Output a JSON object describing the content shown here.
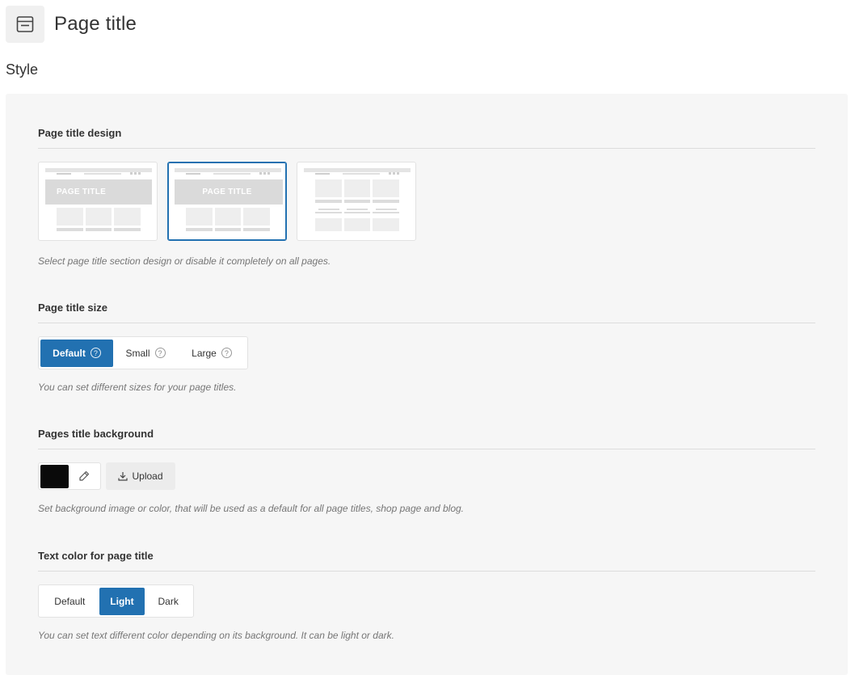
{
  "header": {
    "title": "Page title",
    "icon": "window-icon"
  },
  "section": {
    "heading": "Style"
  },
  "design": {
    "title": "Page title design",
    "options": [
      {
        "label": "PAGE TITLE",
        "selected": false
      },
      {
        "label": "PAGE TITLE",
        "selected": true
      },
      {
        "label": "",
        "selected": false
      }
    ],
    "description": "Select page title section design or disable it completely on all pages."
  },
  "size": {
    "title": "Page title size",
    "options": [
      {
        "label": "Default",
        "active": true
      },
      {
        "label": "Small",
        "active": false
      },
      {
        "label": "Large",
        "active": false
      }
    ],
    "help_glyph": "?",
    "description": "You can set different sizes for your page titles."
  },
  "background": {
    "title": "Pages title background",
    "color": "#0a0a0a",
    "upload_label": "Upload",
    "description": "Set background image or color, that will be used as a default for all page titles, shop page and blog."
  },
  "text_color": {
    "title": "Text color for page title",
    "options": [
      {
        "label": "Default",
        "active": false
      },
      {
        "label": "Light",
        "active": true
      },
      {
        "label": "Dark",
        "active": false
      }
    ],
    "description": "You can set text different color depending on its background. It can be light or dark."
  },
  "colors": {
    "accent": "#2271b1",
    "panel": "#f6f6f6"
  }
}
